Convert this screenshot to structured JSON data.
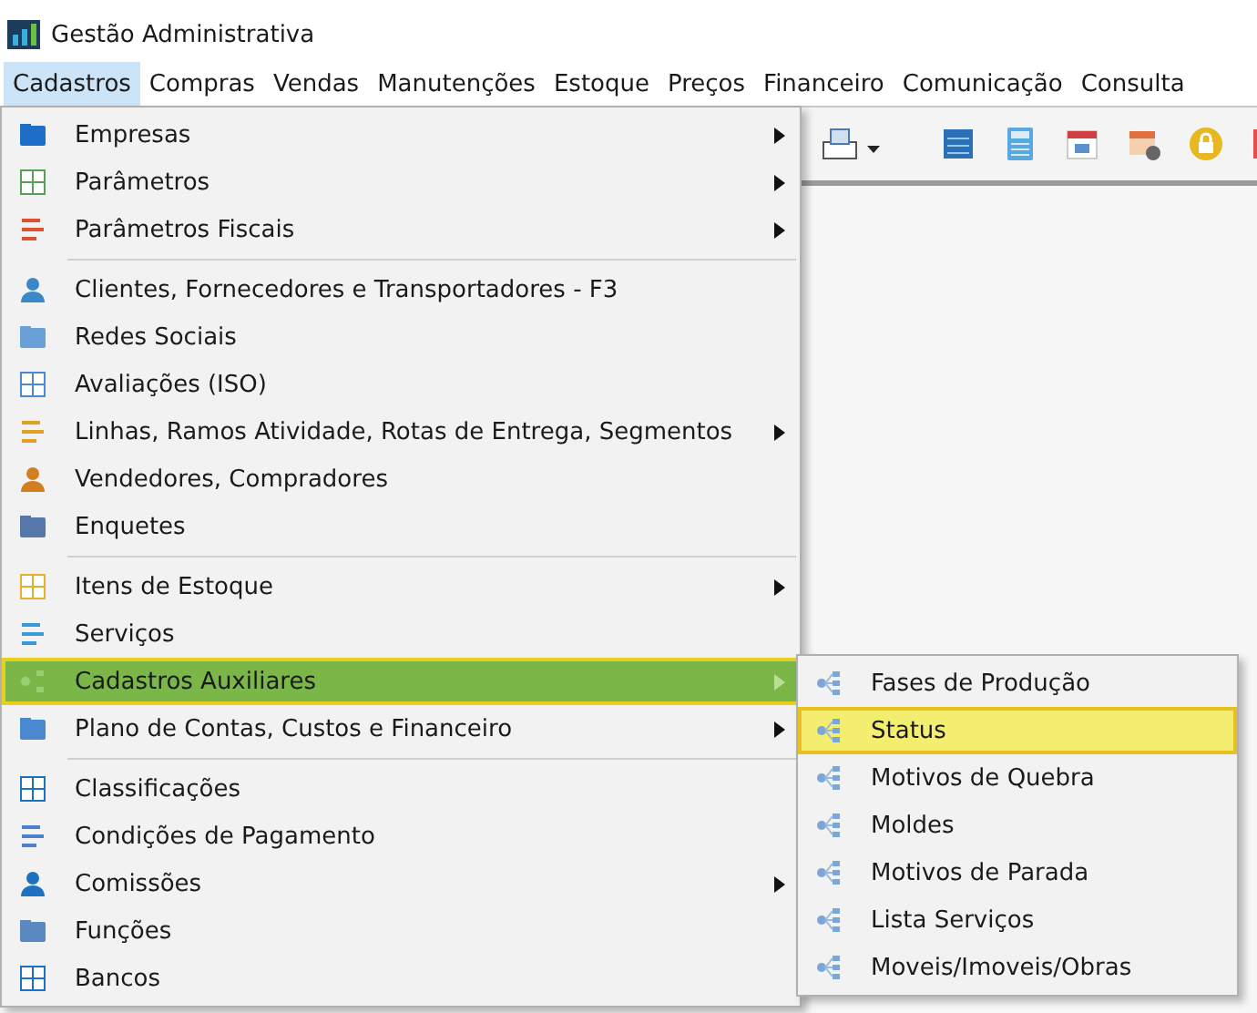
{
  "window": {
    "title": "Gestão Administrativa"
  },
  "menubar": [
    {
      "label": "Cadastros",
      "selected": true
    },
    {
      "label": "Compras",
      "selected": false
    },
    {
      "label": "Vendas",
      "selected": false
    },
    {
      "label": "Manutenções",
      "selected": false
    },
    {
      "label": "Estoque",
      "selected": false
    },
    {
      "label": "Preços",
      "selected": false
    },
    {
      "label": "Financeiro",
      "selected": false
    },
    {
      "label": "Comunicação",
      "selected": false
    },
    {
      "label": "Consulta",
      "selected": false
    }
  ],
  "menu": [
    {
      "kind": "item",
      "label": "Empresas",
      "has_submenu": true,
      "selected": false
    },
    {
      "kind": "item",
      "label": "Parâmetros",
      "has_submenu": true,
      "selected": false
    },
    {
      "kind": "item",
      "label": "Parâmetros Fiscais",
      "has_submenu": true,
      "selected": false
    },
    {
      "kind": "separator"
    },
    {
      "kind": "item",
      "label": "Clientes, Fornecedores e Transportadores - F3",
      "has_submenu": false,
      "selected": false
    },
    {
      "kind": "item",
      "label": "Redes Sociais",
      "has_submenu": false,
      "selected": false
    },
    {
      "kind": "item",
      "label": "Avaliações (ISO)",
      "has_submenu": false,
      "selected": false
    },
    {
      "kind": "item",
      "label": "Linhas, Ramos Atividade, Rotas de Entrega, Segmentos",
      "has_submenu": true,
      "selected": false
    },
    {
      "kind": "item",
      "label": "Vendedores, Compradores",
      "has_submenu": false,
      "selected": false
    },
    {
      "kind": "item",
      "label": "Enquetes",
      "has_submenu": false,
      "selected": false
    },
    {
      "kind": "separator"
    },
    {
      "kind": "item",
      "label": "Itens de Estoque",
      "has_submenu": true,
      "selected": false
    },
    {
      "kind": "item",
      "label": "Serviços",
      "has_submenu": false,
      "selected": false
    },
    {
      "kind": "item",
      "label": "Cadastros Auxiliares",
      "has_submenu": true,
      "selected": true
    },
    {
      "kind": "item",
      "label": "Plano de Contas, Custos e Financeiro",
      "has_submenu": true,
      "selected": false
    },
    {
      "kind": "separator"
    },
    {
      "kind": "item",
      "label": "Classificações",
      "has_submenu": false,
      "selected": false
    },
    {
      "kind": "item",
      "label": "Condições de Pagamento",
      "has_submenu": false,
      "selected": false
    },
    {
      "kind": "item",
      "label": "Comissões",
      "has_submenu": true,
      "selected": false
    },
    {
      "kind": "item",
      "label": "Funções",
      "has_submenu": false,
      "selected": false
    },
    {
      "kind": "item",
      "label": "Bancos",
      "has_submenu": false,
      "selected": false
    }
  ],
  "submenu": [
    {
      "label": "Fases de Produção",
      "selected": false
    },
    {
      "label": "Status",
      "selected": true
    },
    {
      "label": "Motivos de Quebra",
      "selected": false
    },
    {
      "label": "Moldes",
      "selected": false
    },
    {
      "label": "Motivos de Parada",
      "selected": false
    },
    {
      "label": "Lista Serviços",
      "selected": false
    },
    {
      "label": "Moveis/Imoveis/Obras",
      "selected": false
    }
  ]
}
